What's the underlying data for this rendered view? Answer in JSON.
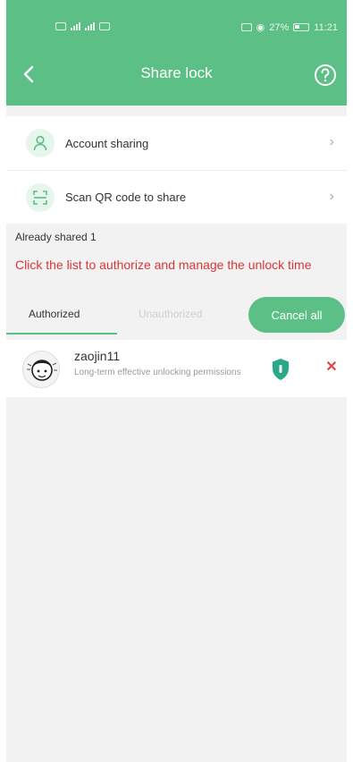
{
  "status_bar": {
    "battery": "27%",
    "time": "11:21"
  },
  "header": {
    "title": "Share lock"
  },
  "options": [
    {
      "label": "Account sharing",
      "icon": "user-icon"
    },
    {
      "label": "Scan QR code to share",
      "icon": "qr-scan-icon"
    }
  ],
  "shared_count": "Already shared 1",
  "hint": "Click the list to authorize and manage the unlock time",
  "tabs": {
    "authorized": "Authorized",
    "unauthorized": "Unauthorized",
    "cancel_all": "Cancel all"
  },
  "users": [
    {
      "name": "zaojin11",
      "description": "Long-term effective unlocking permissions"
    }
  ],
  "colors": {
    "brand": "#5cbf85",
    "alert": "#d93636",
    "shield": "#2aa98a",
    "remove": "#e04848"
  }
}
